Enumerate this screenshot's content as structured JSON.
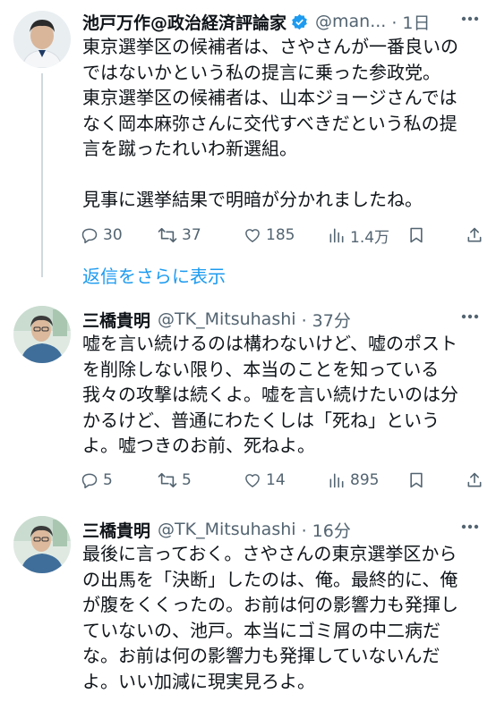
{
  "tweets": [
    {
      "name": "池戸万作@政治経済評論家",
      "handle": "@man...",
      "time": "· 1日",
      "verified": true,
      "text": "東京選挙区の候補者は、さやさんが一番良いの\nではないかという私の提言に乗った参政党。\n東京選挙区の候補者は、山本ジョージさんでは\nなく岡本麻弥さんに交代すべきだという私の提\n言を蹴ったれいわ新選組。\n\n見事に選挙結果で明暗が分かれましたね。",
      "replies": "30",
      "retweets": "37",
      "likes": "185",
      "views": "1.4万"
    },
    {
      "name": "三橋貴明",
      "handle": "@TK_Mitsuhashi",
      "time": "· 37分",
      "verified": false,
      "text": "嘘を言い続けるのは構わないけど、嘘のポスト\nを削除しない限り、本当のことを知っている\n我々の攻撃は続くよ。嘘を言い続けたいのは分\nかるけど、普通にわたくしは「死ね」という\nよ。嘘つきのお前、死ねよ。",
      "replies": "5",
      "retweets": "5",
      "likes": "14",
      "views": "895"
    },
    {
      "name": "三橋貴明",
      "handle": "@TK_Mitsuhashi",
      "time": "· 16分",
      "verified": false,
      "text": "最後に言っておく。さやさんの東京選挙区から\nの出馬を「決断」したのは、俺。最終的に、俺\nが腹をくくったの。お前は何の影響力も発揮し\nていないの、池戸。本当にゴミ屑の中二病だ\nな。お前は何の影響力も発揮していないんだ\nよ。いい加減に現実見ろよ。"
    }
  ],
  "show_replies_label": "返信をさらに表示",
  "colors": {
    "accent": "#1d9bf0",
    "secondary_text": "#536471",
    "thread_line": "#cfd9de"
  },
  "icons": [
    "verified-badge-icon",
    "more-icon",
    "reply-icon",
    "retweet-icon",
    "like-icon",
    "views-icon",
    "bookmark-icon",
    "share-icon"
  ]
}
